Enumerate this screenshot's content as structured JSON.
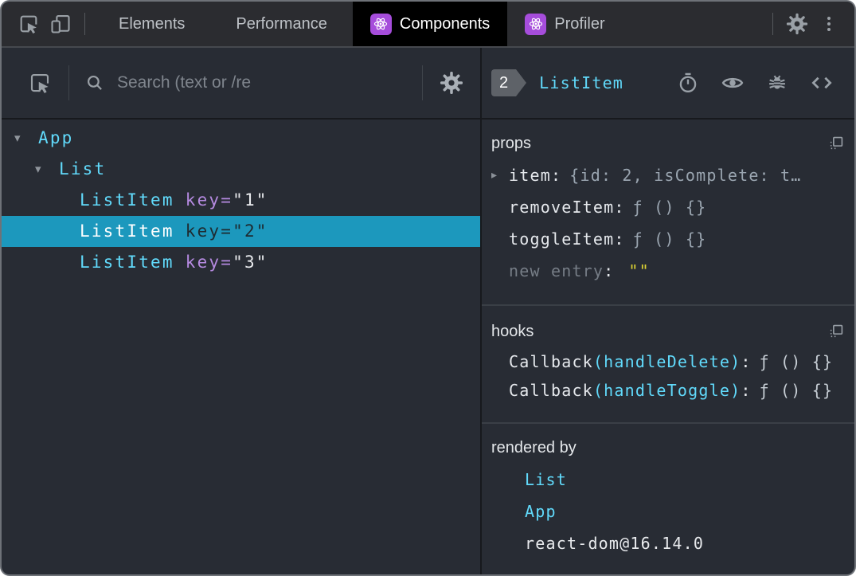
{
  "tabbar": {
    "tabs": [
      {
        "label": "Elements"
      },
      {
        "label": "Performance"
      },
      {
        "label": "Components"
      },
      {
        "label": "Profiler"
      }
    ]
  },
  "left_panel": {
    "search": {
      "placeholder": "Search (text or /re"
    },
    "tree": {
      "rows": [
        {
          "twisty": "▾",
          "name": "App"
        },
        {
          "twisty": "▾",
          "name": "List"
        },
        {
          "name": "ListItem",
          "key_label": "key=",
          "key_value": "\"1\""
        },
        {
          "name": "ListItem",
          "key_label": "key=",
          "key_value": "\"2\"",
          "selected": true
        },
        {
          "name": "ListItem",
          "key_label": "key=",
          "key_value": "\"3\""
        }
      ]
    }
  },
  "right_panel": {
    "header": {
      "badge": "2",
      "title": "ListItem"
    },
    "props": {
      "label": "props",
      "rows": [
        {
          "twisty": "▸",
          "name": "item",
          "sep": ":",
          "value": "{id: 2, isComplete: t…"
        },
        {
          "name": "removeItem",
          "sep": ":",
          "value": "ƒ () {}"
        },
        {
          "name": "toggleItem",
          "sep": ":",
          "value": "ƒ () {}"
        },
        {
          "name": "new entry",
          "sep": ":",
          "value": "\"\""
        }
      ]
    },
    "hooks": {
      "label": "hooks",
      "rows": [
        {
          "name": "Callback",
          "hook": "(handleDelete)",
          "sep": ":",
          "value": "ƒ () {}"
        },
        {
          "name": "Callback",
          "hook": "(handleToggle)",
          "sep": ":",
          "value": "ƒ () {}"
        }
      ]
    },
    "rendered_by": {
      "label": "rendered by",
      "items": [
        {
          "label": "List"
        },
        {
          "label": "App"
        },
        {
          "label": "react-dom@16.14.0"
        }
      ]
    }
  },
  "icons": {
    "tabbar": [
      "inspect-icon",
      "device-toolbar-icon",
      "react-logo-icon",
      "settings-gear-icon",
      "kebab-menu-icon"
    ],
    "left_toolbar": [
      "inspect-icon",
      "search-icon",
      "settings-gear-icon"
    ],
    "right_header": [
      "stopwatch-icon",
      "eye-icon",
      "bug-icon",
      "view-source-icon"
    ],
    "sections": [
      "copy-icon"
    ]
  },
  "colors": {
    "accent_cyan": "#61dafb",
    "selected_row_bg": "#1c98bd",
    "attribute_purple": "#b58ae0",
    "string_yellow": "#ddd333",
    "react_icon_purple": "#a64ddb",
    "background": "#282c34"
  }
}
